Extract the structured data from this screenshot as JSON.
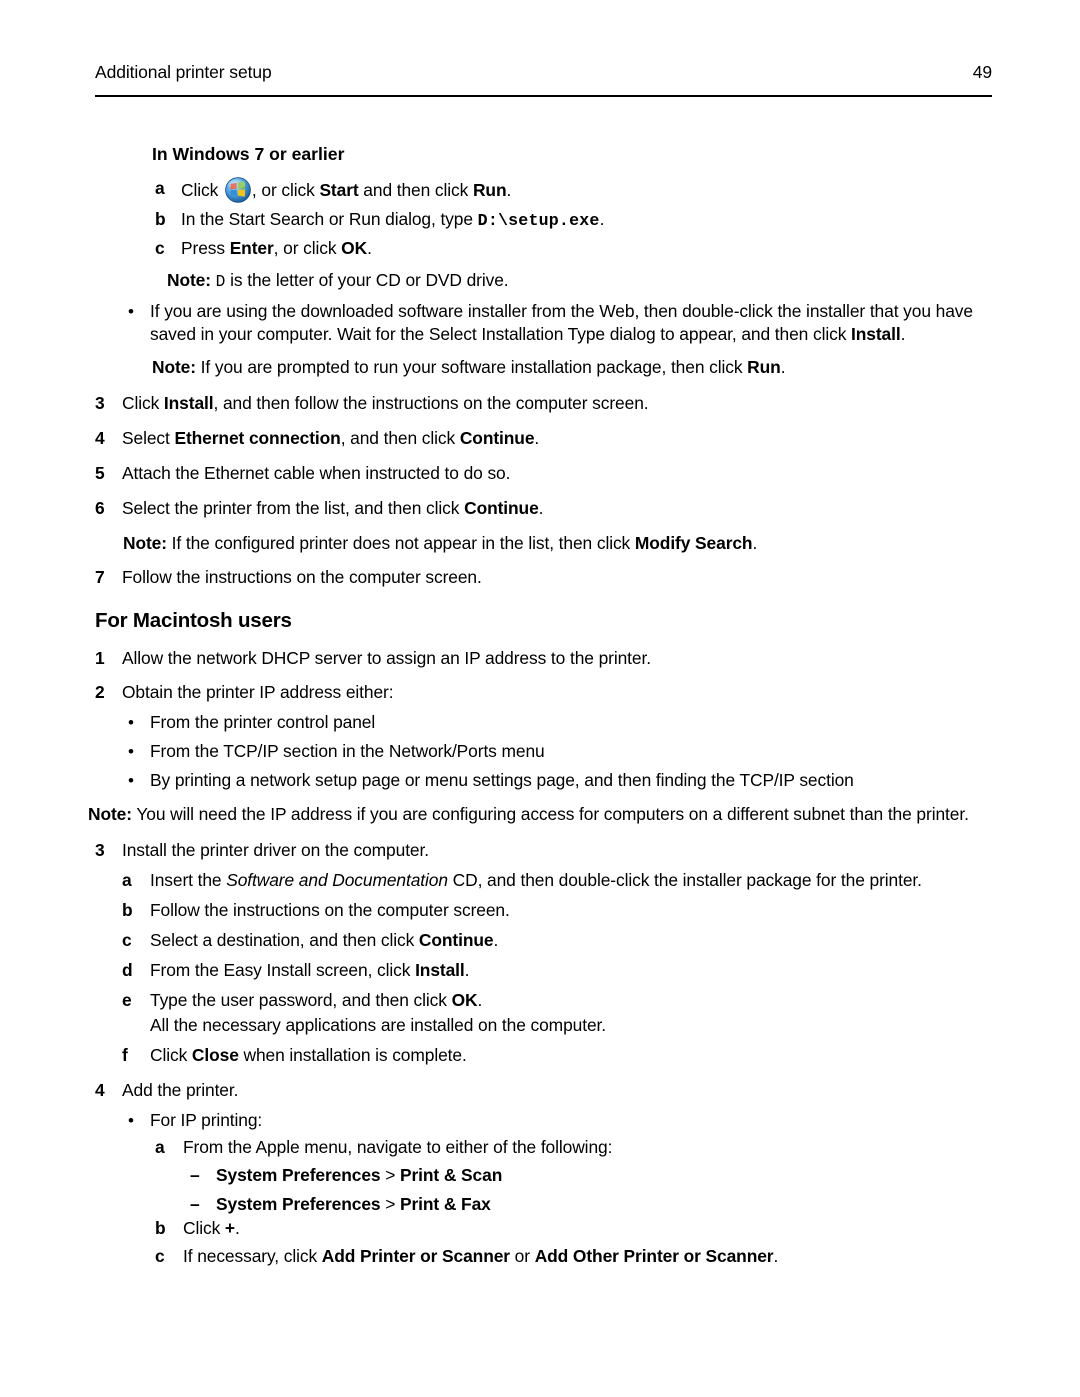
{
  "header": {
    "title": "Additional printer setup",
    "page_number": "49"
  },
  "windows_section": {
    "heading": "In Windows 7 or earlier",
    "steps": [
      {
        "marker": "a",
        "prefix": "Click ",
        "icon": "windows-start-orb-icon",
        "after_icon": ", or click ",
        "bold1": "Start",
        "mid": " and then click ",
        "bold2": "Run",
        "suffix": "."
      },
      {
        "marker": "b",
        "prefix": "In the Start Search or Run dialog, type ",
        "code": "D:\\setup.exe",
        "suffix": "."
      },
      {
        "marker": "c",
        "prefix": "Press ",
        "bold1": "Enter",
        "mid": ", or click ",
        "bold2": "OK",
        "suffix": "."
      }
    ],
    "note_a": {
      "label": "Note:",
      "code": "D",
      "text": " is the letter of your CD or DVD drive."
    },
    "web_bullet": {
      "line1": "If you are using the downloaded software installer from the Web, then double‑click the installer that you have",
      "line2_prefix": "saved in your computer. Wait for the Select Installation Type dialog to appear, and then click ",
      "line2_bold": "Install",
      "line2_suffix": "."
    },
    "note_b": {
      "label": "Note:",
      "text_prefix": " If you are prompted to run your software installation package, then click ",
      "bold": "Run",
      "suffix": "."
    }
  },
  "windows_numbered": [
    {
      "marker": "3",
      "prefix": "Click ",
      "bold1": "Install",
      "suffix": ", and then follow the instructions on the computer screen."
    },
    {
      "marker": "4",
      "prefix": "Select ",
      "bold1": "Ethernet connection",
      "mid": ", and then click ",
      "bold2": "Continue",
      "suffix": "."
    },
    {
      "marker": "5",
      "prefix": "Attach the Ethernet cable when instructed to do so."
    },
    {
      "marker": "6",
      "prefix": "Select the printer from the list, and then click ",
      "bold1": "Continue",
      "suffix": "."
    }
  ],
  "windows_note_c": {
    "label": "Note:",
    "text_prefix": " If the configured printer does not appear in the list, then click ",
    "bold": "Modify Search",
    "suffix": "."
  },
  "windows_step7": {
    "marker": "7",
    "text": "Follow the instructions on the computer screen."
  },
  "macintosh_section": {
    "heading": "For Macintosh users",
    "step1": {
      "marker": "1",
      "text": "Allow the network DHCP server to assign an IP address to the printer."
    },
    "step2": {
      "marker": "2",
      "text": "Obtain the printer IP address either:"
    },
    "step2_bullets": [
      "From the printer control panel",
      "From the TCP/IP section in the Network/Ports menu",
      "By printing a network setup page or menu settings page, and then finding the TCP/IP section"
    ],
    "note": {
      "label": "Note:",
      "text": " You will need the IP address if you are configuring access for computers on a different subnet than the printer."
    },
    "step3": {
      "marker": "3",
      "text": "Install the printer driver on the computer."
    },
    "step3_sub": [
      {
        "marker": "a",
        "prefix": "Insert the ",
        "italic": "Software and Documentation",
        "suffix": " CD, and then double‑click the installer package for the printer."
      },
      {
        "marker": "b",
        "prefix": "Follow the instructions on the computer screen."
      },
      {
        "marker": "c",
        "prefix": "Select a destination, and then click ",
        "bold1": "Continue",
        "suffix": "."
      },
      {
        "marker": "d",
        "prefix": "From the Easy Install screen, click ",
        "bold1": "Install",
        "suffix": "."
      },
      {
        "marker": "e",
        "prefix": "Type the user password, and then click ",
        "bold1": "OK",
        "suffix": "."
      }
    ],
    "step3e_continuation": "All the necessary applications are installed on the computer.",
    "step3f": {
      "marker": "f",
      "prefix": "Click ",
      "bold1": "Close",
      "suffix": " when installation is complete."
    },
    "step4": {
      "marker": "4",
      "text": "Add the printer."
    },
    "step4_bullet": "For IP printing:",
    "step4_sub_a": {
      "marker": "a",
      "text": "From the Apple menu, navigate to either of the following:"
    },
    "step4_dashes": [
      {
        "dash": "–",
        "bold1": "System Preferences",
        "sep": " > ",
        "bold2": "Print & Scan"
      },
      {
        "dash": "–",
        "bold1": "System Preferences",
        "sep": " > ",
        "bold2": "Print & Fax"
      }
    ],
    "step4_sub_b": {
      "marker": "b",
      "prefix": "Click ",
      "bold1": "+",
      "suffix": "."
    },
    "step4_sub_c": {
      "marker": "c",
      "prefix": "If necessary, click ",
      "bold1": "Add Printer or Scanner",
      "mid": " or ",
      "bold2": "Add Other Printer or Scanner",
      "suffix": "."
    }
  },
  "colors": {
    "text": "#000000",
    "background": "#ffffff",
    "rule": "#000000",
    "orb_blue_light": "#7fc3f0",
    "orb_blue_dark": "#1b60b0",
    "orb_red": "#e8503a",
    "orb_green": "#7cc242",
    "orb_blue_tile": "#2f8fd8",
    "orb_yellow": "#f2c21c"
  }
}
